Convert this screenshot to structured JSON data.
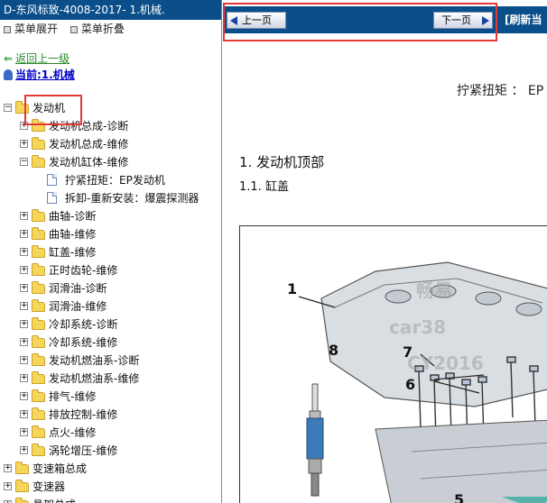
{
  "left": {
    "title": "D-东风标致-4008-2017- 1.机械.",
    "menu_expand": "菜单展开",
    "menu_collapse": "菜单折叠",
    "back_link": "返回上一级",
    "current": "当前:1.机械",
    "tree": [
      {
        "label": "发动机",
        "depth": 0,
        "expander": "−",
        "kind": "folder"
      },
      {
        "label": "发动机总成-诊断",
        "depth": 1,
        "expander": "+",
        "kind": "folder"
      },
      {
        "label": "发动机总成-维修",
        "depth": 1,
        "expander": "+",
        "kind": "folder"
      },
      {
        "label": "发动机缸体-维修",
        "depth": 1,
        "expander": "−",
        "kind": "folder"
      },
      {
        "label": "拧紧扭矩：EP发动机",
        "depth": 2,
        "expander": "",
        "kind": "doc"
      },
      {
        "label": "拆卸-重新安装：爆震探测器",
        "depth": 2,
        "expander": "",
        "kind": "doc"
      },
      {
        "label": "曲轴-诊断",
        "depth": 1,
        "expander": "+",
        "kind": "folder"
      },
      {
        "label": "曲轴-维修",
        "depth": 1,
        "expander": "+",
        "kind": "folder"
      },
      {
        "label": "缸盖-维修",
        "depth": 1,
        "expander": "+",
        "kind": "folder"
      },
      {
        "label": "正时齿轮-维修",
        "depth": 1,
        "expander": "+",
        "kind": "folder"
      },
      {
        "label": "润滑油-诊断",
        "depth": 1,
        "expander": "+",
        "kind": "folder"
      },
      {
        "label": "润滑油-维修",
        "depth": 1,
        "expander": "+",
        "kind": "folder"
      },
      {
        "label": "冷却系统-诊断",
        "depth": 1,
        "expander": "+",
        "kind": "folder"
      },
      {
        "label": "冷却系统-维修",
        "depth": 1,
        "expander": "+",
        "kind": "folder"
      },
      {
        "label": "发动机燃油系-诊断",
        "depth": 1,
        "expander": "+",
        "kind": "folder"
      },
      {
        "label": "发动机燃油系-维修",
        "depth": 1,
        "expander": "+",
        "kind": "folder"
      },
      {
        "label": "排气-维修",
        "depth": 1,
        "expander": "+",
        "kind": "folder"
      },
      {
        "label": "排放控制-维修",
        "depth": 1,
        "expander": "+",
        "kind": "folder"
      },
      {
        "label": "点火-维修",
        "depth": 1,
        "expander": "+",
        "kind": "folder"
      },
      {
        "label": "涡轮增压-维修",
        "depth": 1,
        "expander": "+",
        "kind": "folder"
      },
      {
        "label": "变速箱总成",
        "depth": 0,
        "expander": "+",
        "kind": "folder"
      },
      {
        "label": "变速器",
        "depth": 0,
        "expander": "+",
        "kind": "folder"
      },
      {
        "label": "悬架总成",
        "depth": 0,
        "expander": "+",
        "kind": "folder"
      }
    ]
  },
  "toolbar": {
    "prev": "上一页",
    "next": "下一页",
    "refresh": "[刷新当"
  },
  "content": {
    "torque_line": "拧紧扭矩 ： EP",
    "heading1": "1.  发动机顶部",
    "heading2": "1.1.  缸盖",
    "callouts": [
      "1",
      "8",
      "7",
      "6",
      "5"
    ],
    "watermarks": [
      "畅易",
      "car38",
      "CY2016"
    ]
  },
  "colors": {
    "titlebar": "#0b4f8a",
    "highlight_box": "#e53935",
    "link_green": "#2c8a2c",
    "link_blue": "#0000c8"
  }
}
